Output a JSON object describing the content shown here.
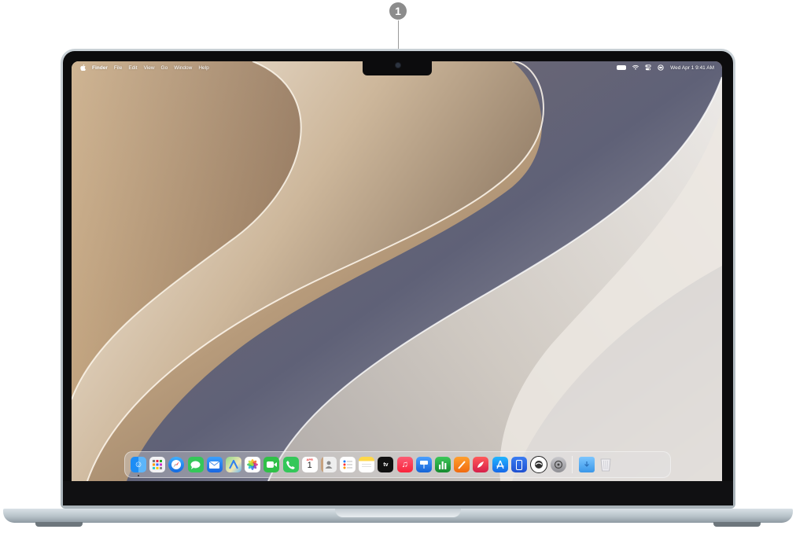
{
  "callout": {
    "number": "1"
  },
  "menubar": {
    "items": [
      "Finder",
      "File",
      "Edit",
      "View",
      "Go",
      "Window",
      "Help"
    ],
    "datetime": "Wed Apr 1  9:41 AM"
  },
  "dock": {
    "calendar": {
      "month": "APR",
      "day": "1"
    },
    "tv_label": "tv",
    "apps": [
      "Finder",
      "Launchpad",
      "Safari",
      "Messages",
      "Mail",
      "Maps",
      "Photos",
      "FaceTime",
      "Phone",
      "Calendar",
      "Contacts",
      "Reminders",
      "Notes",
      "TV",
      "Music",
      "Keynote",
      "Numbers",
      "Pages",
      "Rocket",
      "App Store",
      "iPhone Mirroring",
      "ChatGPT",
      "System Settings",
      "Downloads",
      "Trash"
    ]
  },
  "colors": {
    "finder": "#1e7ef2",
    "launchpad": "#f2f2f4",
    "safari": "#1a8cf0",
    "messages": "#35c759",
    "mail": "#1b7cf5",
    "photos": "#ffffff",
    "facetime": "#30c048",
    "phone": "#34c759",
    "music": "#fa2d48",
    "keynote": "#1877e6",
    "numbers": "#20a33a",
    "pages": "#f38a1a",
    "appstore": "#1b8cf5",
    "tv": "#111111",
    "notes": "#ffffff",
    "downloads": "#4aa5f0"
  }
}
